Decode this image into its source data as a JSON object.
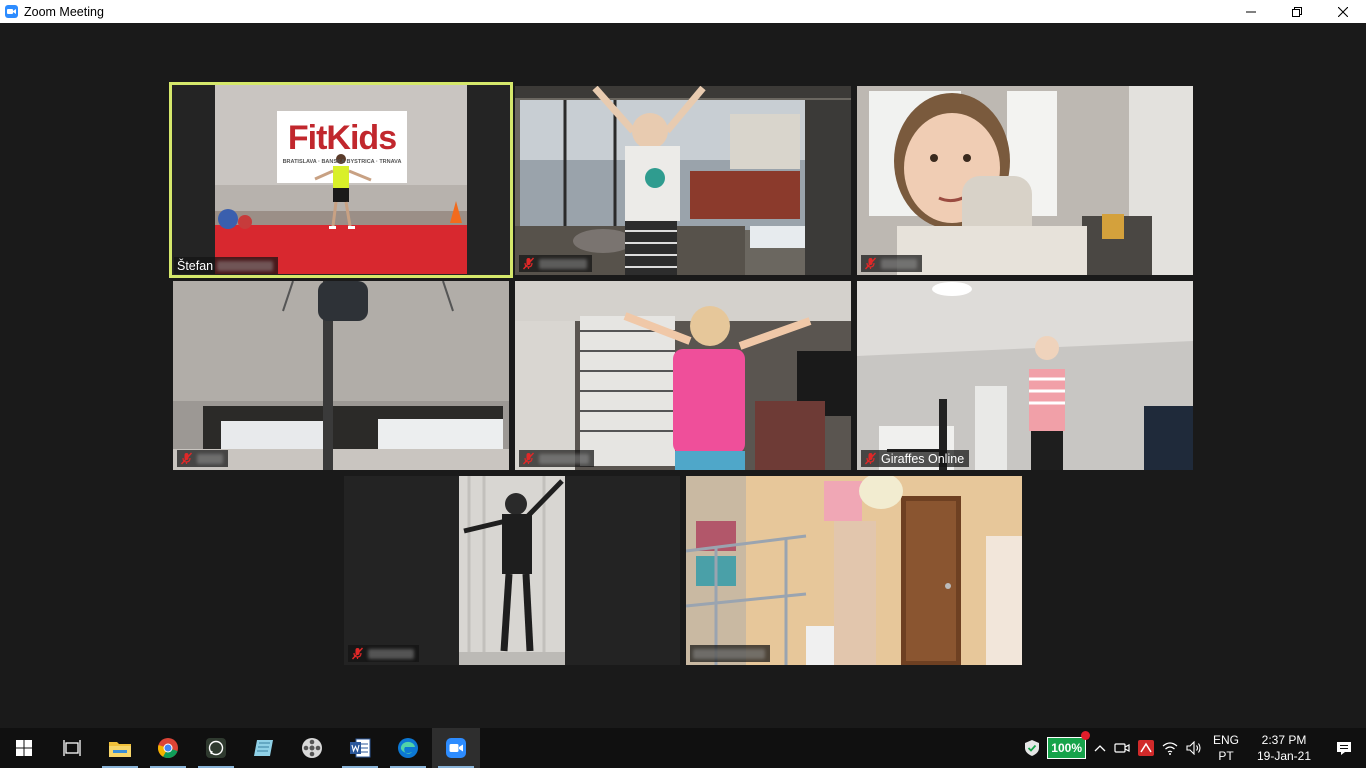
{
  "window": {
    "title": "Zoom Meeting",
    "controls": {
      "minimize": "minimize-icon",
      "restore": "restore-icon",
      "close": "close-icon"
    }
  },
  "participants": [
    {
      "name": "Štefan",
      "name_suffix_blurred": true,
      "muted": false,
      "active_speaker": true
    },
    {
      "name": "",
      "name_blurred": true,
      "muted": true,
      "active_speaker": false
    },
    {
      "name": "",
      "name_blurred": true,
      "muted": true,
      "active_speaker": false
    },
    {
      "name": "",
      "name_blurred": true,
      "muted": true,
      "active_speaker": false
    },
    {
      "name": "",
      "name_blurred": true,
      "muted": true,
      "active_speaker": false
    },
    {
      "name": "Giraffes Online",
      "muted": true,
      "active_speaker": false
    },
    {
      "name": "",
      "name_blurred": true,
      "muted": true,
      "active_speaker": false
    },
    {
      "name": "",
      "name_blurred": true,
      "muted": false,
      "active_speaker": false
    }
  ],
  "banner": {
    "logo_text": "FitKids",
    "tagline": "BRATISLAVA · BANSKÁ BYSTRICA · TRNAVA"
  },
  "taskbar": {
    "apps": [
      "start-icon",
      "task-view-icon",
      "file-explorer-icon",
      "chrome-icon",
      "whatsapp-icon",
      "note-app-icon",
      "film-reel-icon",
      "word-icon",
      "edge-icon",
      "zoom-icon"
    ],
    "battery": "100%",
    "language_top": "ENG",
    "language_bottom": "PT",
    "time": "2:37 PM",
    "date": "19-Jan-21"
  },
  "colors": {
    "active_speaker_border": "#d5e86b",
    "zoom_blue": "#2d8cff",
    "muted_red": "#e02828",
    "battery_green": "#16a34a"
  }
}
